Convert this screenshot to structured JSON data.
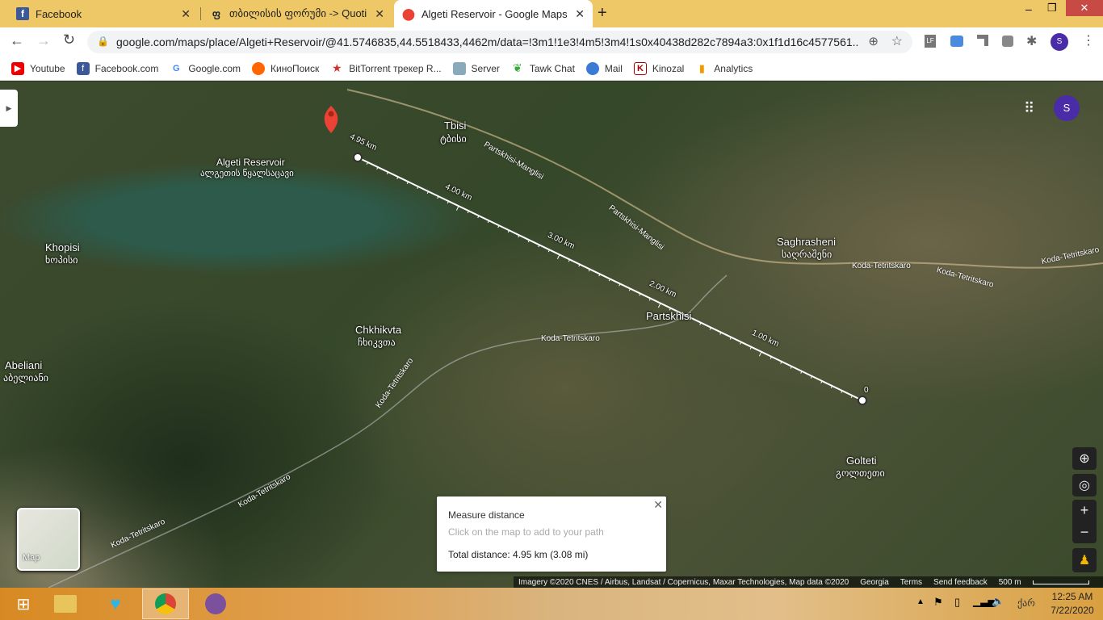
{
  "tabs": [
    {
      "title": "Facebook",
      "icon": "facebook-icon"
    },
    {
      "title": "თბილისის ფორუმი -> Quotin",
      "icon": "forum-icon"
    },
    {
      "title": "Algeti Reservoir - Google Maps",
      "icon": "maps-pin-icon"
    }
  ],
  "new_tab": "+",
  "url": "google.com/maps/place/Algeti+Reservoir/@41.5746835,44.5518433,4462m/data=!3m1!1e3!4m5!3m4!1s0x40438d282c7894a3:0x1f1d16c4577561...",
  "profile_initial": "S",
  "bookmarks": [
    "Youtube",
    "Facebook.com",
    "Google.com",
    "КиноПоиск",
    "BitTorrent трекер R...",
    "Server",
    "Tawk Chat",
    "Mail",
    "Kinozal",
    "Analytics"
  ],
  "map": {
    "places": [
      {
        "name": "Algeti Reservoir",
        "local": "ალგეთის წყალსაცავი"
      },
      {
        "name": "Tbisi",
        "local": "ტბისი"
      },
      {
        "name": "Saghrasheni",
        "local": "საღრაშენი"
      },
      {
        "name": "Khopisi",
        "local": "ხოპისი"
      },
      {
        "name": "Abeliani",
        "local": "აბელიანი"
      },
      {
        "name": "Chkhikvta",
        "local": "ჩხიკვთა"
      },
      {
        "name": "Partskhisi",
        "local": ""
      },
      {
        "name": "Golteti",
        "local": "გოლთეთი"
      }
    ],
    "roads": [
      "Partskhisi-Manglisi",
      "Partskhisi-Manglisi",
      "Koda-Tetritskaro",
      "Koda-Tetritskaro",
      "Koda-Tetritskaro",
      "Koda-Tetritskaro",
      "Koda-Tetritskaro",
      "Koda-Tetritskaro",
      "Koda-Tetritskaro"
    ],
    "distance_marks": [
      "4.95 km",
      "4.00 km",
      "3.00 km",
      "2.00 km",
      "1.00 km",
      "0"
    ],
    "layer_label": "Map",
    "user_initial": "S"
  },
  "measure": {
    "title": "Measure distance",
    "hint": "Click on the map to add to your path",
    "total": "Total distance: 4.95 km (3.08 mi)"
  },
  "attribution": {
    "imagery": "Imagery ©2020 CNES / Airbus, Landsat / Copernicus, Maxar Technologies, Map data ©2020",
    "country": "Georgia",
    "terms": "Terms",
    "feedback": "Send feedback",
    "scale": "500 m"
  },
  "taskbar": {
    "lang": "ქარ",
    "time": "12:25 AM",
    "date": "7/22/2020"
  }
}
